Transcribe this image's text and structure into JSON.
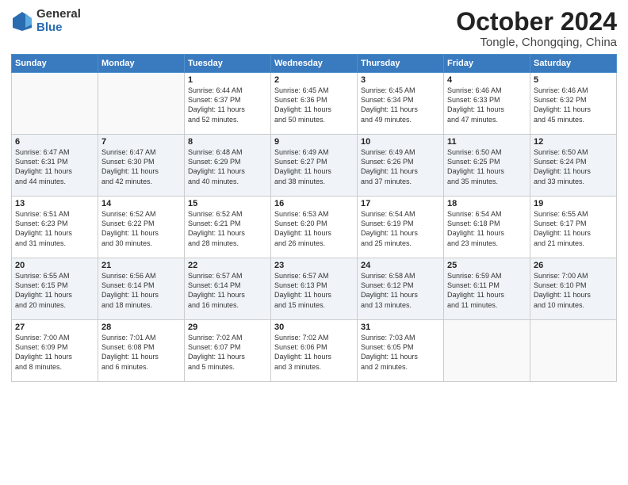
{
  "header": {
    "logo_general": "General",
    "logo_blue": "Blue",
    "month_title": "October 2024",
    "location": "Tongle, Chongqing, China"
  },
  "days_of_week": [
    "Sunday",
    "Monday",
    "Tuesday",
    "Wednesday",
    "Thursday",
    "Friday",
    "Saturday"
  ],
  "weeks": [
    [
      {
        "day": "",
        "info": ""
      },
      {
        "day": "",
        "info": ""
      },
      {
        "day": "1",
        "info": "Sunrise: 6:44 AM\nSunset: 6:37 PM\nDaylight: 11 hours\nand 52 minutes."
      },
      {
        "day": "2",
        "info": "Sunrise: 6:45 AM\nSunset: 6:36 PM\nDaylight: 11 hours\nand 50 minutes."
      },
      {
        "day": "3",
        "info": "Sunrise: 6:45 AM\nSunset: 6:34 PM\nDaylight: 11 hours\nand 49 minutes."
      },
      {
        "day": "4",
        "info": "Sunrise: 6:46 AM\nSunset: 6:33 PM\nDaylight: 11 hours\nand 47 minutes."
      },
      {
        "day": "5",
        "info": "Sunrise: 6:46 AM\nSunset: 6:32 PM\nDaylight: 11 hours\nand 45 minutes."
      }
    ],
    [
      {
        "day": "6",
        "info": "Sunrise: 6:47 AM\nSunset: 6:31 PM\nDaylight: 11 hours\nand 44 minutes."
      },
      {
        "day": "7",
        "info": "Sunrise: 6:47 AM\nSunset: 6:30 PM\nDaylight: 11 hours\nand 42 minutes."
      },
      {
        "day": "8",
        "info": "Sunrise: 6:48 AM\nSunset: 6:29 PM\nDaylight: 11 hours\nand 40 minutes."
      },
      {
        "day": "9",
        "info": "Sunrise: 6:49 AM\nSunset: 6:27 PM\nDaylight: 11 hours\nand 38 minutes."
      },
      {
        "day": "10",
        "info": "Sunrise: 6:49 AM\nSunset: 6:26 PM\nDaylight: 11 hours\nand 37 minutes."
      },
      {
        "day": "11",
        "info": "Sunrise: 6:50 AM\nSunset: 6:25 PM\nDaylight: 11 hours\nand 35 minutes."
      },
      {
        "day": "12",
        "info": "Sunrise: 6:50 AM\nSunset: 6:24 PM\nDaylight: 11 hours\nand 33 minutes."
      }
    ],
    [
      {
        "day": "13",
        "info": "Sunrise: 6:51 AM\nSunset: 6:23 PM\nDaylight: 11 hours\nand 31 minutes."
      },
      {
        "day": "14",
        "info": "Sunrise: 6:52 AM\nSunset: 6:22 PM\nDaylight: 11 hours\nand 30 minutes."
      },
      {
        "day": "15",
        "info": "Sunrise: 6:52 AM\nSunset: 6:21 PM\nDaylight: 11 hours\nand 28 minutes."
      },
      {
        "day": "16",
        "info": "Sunrise: 6:53 AM\nSunset: 6:20 PM\nDaylight: 11 hours\nand 26 minutes."
      },
      {
        "day": "17",
        "info": "Sunrise: 6:54 AM\nSunset: 6:19 PM\nDaylight: 11 hours\nand 25 minutes."
      },
      {
        "day": "18",
        "info": "Sunrise: 6:54 AM\nSunset: 6:18 PM\nDaylight: 11 hours\nand 23 minutes."
      },
      {
        "day": "19",
        "info": "Sunrise: 6:55 AM\nSunset: 6:17 PM\nDaylight: 11 hours\nand 21 minutes."
      }
    ],
    [
      {
        "day": "20",
        "info": "Sunrise: 6:55 AM\nSunset: 6:15 PM\nDaylight: 11 hours\nand 20 minutes."
      },
      {
        "day": "21",
        "info": "Sunrise: 6:56 AM\nSunset: 6:14 PM\nDaylight: 11 hours\nand 18 minutes."
      },
      {
        "day": "22",
        "info": "Sunrise: 6:57 AM\nSunset: 6:14 PM\nDaylight: 11 hours\nand 16 minutes."
      },
      {
        "day": "23",
        "info": "Sunrise: 6:57 AM\nSunset: 6:13 PM\nDaylight: 11 hours\nand 15 minutes."
      },
      {
        "day": "24",
        "info": "Sunrise: 6:58 AM\nSunset: 6:12 PM\nDaylight: 11 hours\nand 13 minutes."
      },
      {
        "day": "25",
        "info": "Sunrise: 6:59 AM\nSunset: 6:11 PM\nDaylight: 11 hours\nand 11 minutes."
      },
      {
        "day": "26",
        "info": "Sunrise: 7:00 AM\nSunset: 6:10 PM\nDaylight: 11 hours\nand 10 minutes."
      }
    ],
    [
      {
        "day": "27",
        "info": "Sunrise: 7:00 AM\nSunset: 6:09 PM\nDaylight: 11 hours\nand 8 minutes."
      },
      {
        "day": "28",
        "info": "Sunrise: 7:01 AM\nSunset: 6:08 PM\nDaylight: 11 hours\nand 6 minutes."
      },
      {
        "day": "29",
        "info": "Sunrise: 7:02 AM\nSunset: 6:07 PM\nDaylight: 11 hours\nand 5 minutes."
      },
      {
        "day": "30",
        "info": "Sunrise: 7:02 AM\nSunset: 6:06 PM\nDaylight: 11 hours\nand 3 minutes."
      },
      {
        "day": "31",
        "info": "Sunrise: 7:03 AM\nSunset: 6:05 PM\nDaylight: 11 hours\nand 2 minutes."
      },
      {
        "day": "",
        "info": ""
      },
      {
        "day": "",
        "info": ""
      }
    ]
  ]
}
